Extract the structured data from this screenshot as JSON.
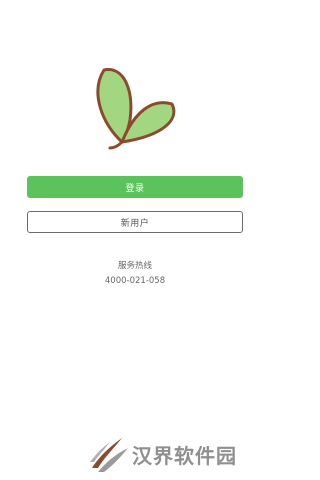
{
  "login_button": {
    "label": "登录"
  },
  "register_button": {
    "label": "新用户"
  },
  "service": {
    "label": "服务热线",
    "phone": "4000-021-058"
  },
  "watermark": {
    "text": "汉界软件园"
  },
  "colors": {
    "login_green": "#5cc35c",
    "leaf_fill": "#a2d680",
    "leaf_stroke": "#8b4a2b",
    "text_gray": "#666666"
  }
}
